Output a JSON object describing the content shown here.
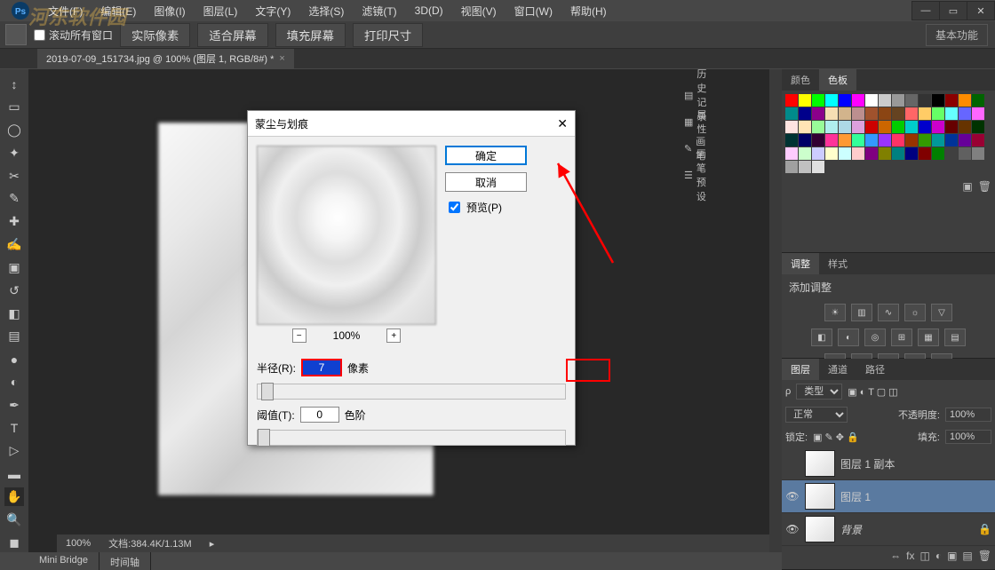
{
  "menu": {
    "file": "文件(F)",
    "edit": "编辑(E)",
    "image": "图像(I)",
    "layer": "图层(L)",
    "type": "文字(Y)",
    "select": "选择(S)",
    "filter": "滤镜(T)",
    "d3": "3D(D)",
    "view": "视图(V)",
    "window": "窗口(W)",
    "help": "帮助(H)"
  },
  "watermark": "河东软件园",
  "optbar": {
    "scroll_all": "滚动所有窗口",
    "actual": "实际像素",
    "fit": "适合屏幕",
    "fill": "填充屏幕",
    "print": "打印尺寸",
    "basic": "基本功能"
  },
  "document": {
    "tab": "2019-07-09_151734.jpg @ 100% (图层 1, RGB/8#) *",
    "close": "×"
  },
  "status": {
    "zoom": "100%",
    "doc": "文档:384.4K/1.13M"
  },
  "bottom_tabs": {
    "mini": "Mini Bridge",
    "timeline": "时间轴"
  },
  "side_panels": {
    "history": "历史记录",
    "properties": "属性",
    "brush": "画笔",
    "brush_preset": "画笔预设"
  },
  "panel_right": {
    "color_tab": "颜色",
    "swatches_tab": "色板",
    "adjust_tab": "调整",
    "styles_tab": "样式",
    "add_adjust": "添加调整",
    "layers_tab": "图层",
    "channels_tab": "通道",
    "paths_tab": "路径",
    "kind": "类型",
    "blend": "正常",
    "opacity_lbl": "不透明度:",
    "opacity": "100%",
    "lock_lbl": "锁定:",
    "fill_lbl": "填充:",
    "fill": "100%",
    "layers": [
      {
        "name": "图层 1 副本"
      },
      {
        "name": "图层 1"
      },
      {
        "name": "背景"
      }
    ]
  },
  "dialog": {
    "title": "蒙尘与划痕",
    "ok": "确定",
    "cancel": "取消",
    "preview": "预览(P)",
    "zoom": "100%",
    "radius_lbl": "半径(R):",
    "radius_val": "7",
    "radius_unit": "像素",
    "threshold_lbl": "阈值(T):",
    "threshold_val": "0",
    "threshold_unit": "色阶"
  }
}
